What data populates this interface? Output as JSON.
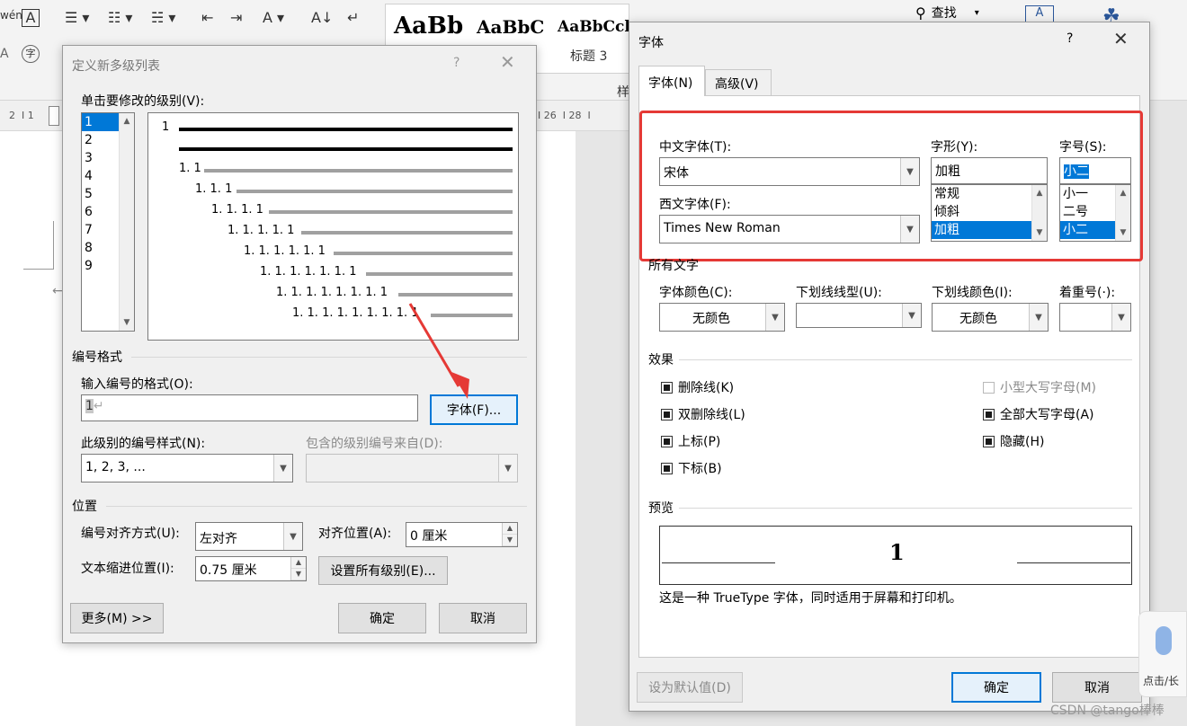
{
  "ribbon": {
    "style_samples": [
      "AaBb",
      "AaBbC",
      "AaBbCcl"
    ],
    "heading3_label": "标题 3",
    "styles_group_label": "样",
    "find_label": "查找",
    "ruler_ticks_left": [
      "2",
      "1",
      "2"
    ],
    "ruler_ticks_right": [
      "26",
      "28"
    ]
  },
  "multilevel_dialog": {
    "title": "定义新多级列表",
    "help": "?",
    "levels_label": "单击要修改的级别(V):",
    "levels": [
      "1",
      "2",
      "3",
      "4",
      "5",
      "6",
      "7",
      "8",
      "9"
    ],
    "selected_level": "1",
    "preview_labels": [
      "1",
      "1. 1",
      "1. 1. 1",
      "1. 1. 1. 1",
      "1. 1. 1. 1. 1",
      "1. 1. 1. 1. 1. 1",
      "1. 1. 1. 1. 1. 1. 1",
      "1. 1. 1. 1. 1. 1. 1. 1",
      "1. 1. 1. 1. 1. 1. 1. 1. 1"
    ],
    "numbering_group": "编号格式",
    "enter_format_label": "输入编号的格式(O):",
    "format_value": "1",
    "font_button": "字体(F)...",
    "style_label": "此级别的编号样式(N):",
    "style_value": "1, 2, 3, ...",
    "include_label": "包含的级别编号来自(D):",
    "position_group": "位置",
    "align_label": "编号对齐方式(U):",
    "align_value": "左对齐",
    "align_at_label": "对齐位置(A):",
    "align_at_value": "0 厘米",
    "indent_label": "文本缩进位置(I):",
    "indent_value": "0.75 厘米",
    "set_all_button": "设置所有级别(E)...",
    "more_button": "更多(M) >>",
    "ok_button": "确定",
    "cancel_button": "取消"
  },
  "font_dialog": {
    "title": "字体",
    "help": "?",
    "tabs": [
      "字体(N)",
      "高级(V)"
    ],
    "active_tab": "字体(N)",
    "cn_font_label": "中文字体(T):",
    "cn_font_value": "宋体",
    "west_font_label": "西文字体(F):",
    "west_font_value": "Times New Roman",
    "style_label": "字形(Y):",
    "style_value": "加粗",
    "style_options": [
      "常规",
      "倾斜",
      "加粗"
    ],
    "size_label": "字号(S):",
    "size_value": "小二",
    "size_options": [
      "小一",
      "二号",
      "小二"
    ],
    "all_text_group": "所有文字",
    "color_label": "字体颜色(C):",
    "color_value": "无颜色",
    "underline_label": "下划线线型(U):",
    "underline_value": "",
    "underline_color_label": "下划线颜色(I):",
    "underline_color_value": "无颜色",
    "emphasis_label": "着重号(·):",
    "effects_group": "效果",
    "effects": [
      {
        "label": "删除线(K)",
        "checked": true
      },
      {
        "label": "双删除线(L)",
        "checked": true
      },
      {
        "label": "上标(P)",
        "checked": true
      },
      {
        "label": "下标(B)",
        "checked": true
      },
      {
        "label": "小型大写字母(M)",
        "checked": false
      },
      {
        "label": "全部大写字母(A)",
        "checked": true
      },
      {
        "label": "隐藏(H)",
        "checked": true
      }
    ],
    "preview_group": "预览",
    "preview_text": "1",
    "truetype_note": "这是一种 TrueType 字体，同时适用于屏幕和打印机。",
    "default_button": "设为默认值(D)",
    "ok_button": "确定",
    "cancel_button": "取消"
  },
  "voice_widget_label": "点击/长",
  "watermark": "CSDN @tango棒棒",
  "colors": {
    "accent": "#0078d7",
    "highlight_box": "#e53935",
    "arrow": "#e53935"
  }
}
